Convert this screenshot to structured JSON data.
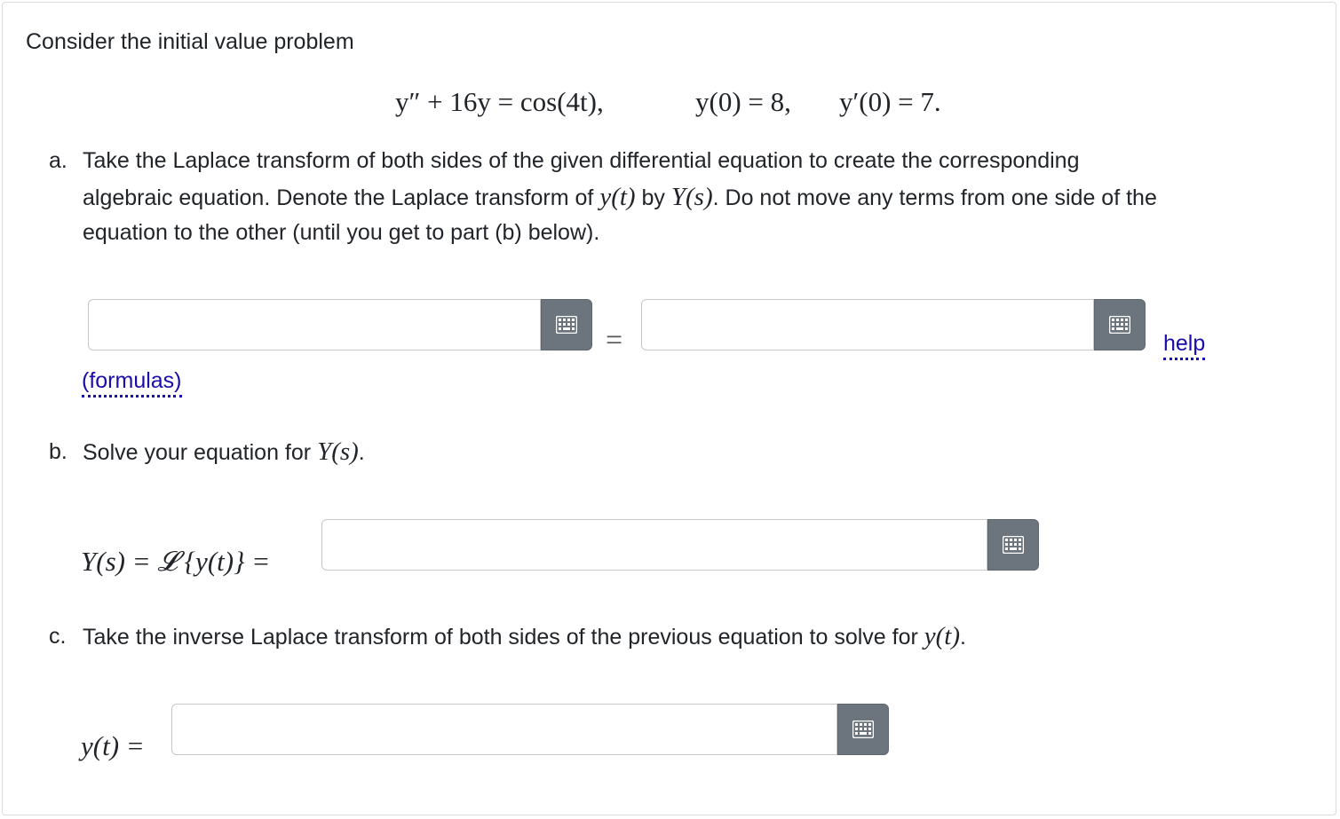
{
  "intro": "Consider the initial value problem",
  "ivp": {
    "lhs": "y″ + 16y = cos(4t),",
    "ic1": "y(0) = 8,",
    "ic2": "y′(0) = 7."
  },
  "part_a": {
    "marker": "a.",
    "line1": "Take the Laplace transform of both sides of the given differential equation to create the corresponding",
    "line2_pre": "algebraic equation. Denote the Laplace transform of",
    "line2_m1": "y(t)",
    "line2_mid": "by",
    "line2_m2": "Y(s)",
    "line2_post": ". Do not move any terms from one side of the",
    "line3": "equation to the other (until you get to part (b) below).",
    "equals": "=",
    "left_value": "",
    "right_value": "",
    "help_link": "help",
    "formulas_link": "(formulas)"
  },
  "part_b": {
    "marker": "b.",
    "text_pre": "Solve your equation for",
    "text_math": "Y(s)",
    "text_post": ".",
    "label": "Y(s) = 𝓛 {y(t)} =",
    "value": ""
  },
  "part_c": {
    "marker": "c.",
    "text_pre": "Take the inverse Laplace transform of both sides of the previous equation to solve for",
    "text_math": "y(t)",
    "text_post": ".",
    "label": "y(t) =",
    "value": ""
  },
  "icons": {
    "keyboard": "keyboard-icon"
  },
  "colors": {
    "button_bg": "#6c757d",
    "link": "#1a0dab"
  }
}
